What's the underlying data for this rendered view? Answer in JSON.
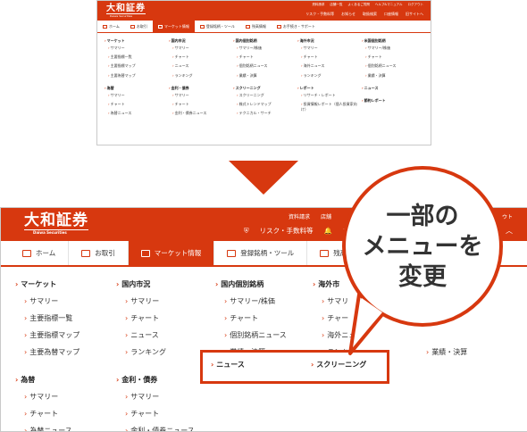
{
  "thumbnail": {
    "logo": "大和証券",
    "logo_sub": "Daiwa Securities",
    "util_top": [
      "資料請求",
      "店舗一覧",
      "よくあるご質問",
      "ヘルプ&マニュアル",
      "ログアウト"
    ],
    "util_bottom": [
      "リスク・手数料等",
      "お知らせ",
      "取扱検索",
      "口座情報",
      "旧サイトへ"
    ],
    "tabs": [
      "ホーム",
      "お取引",
      "マーケット情報",
      "登録銘柄・ツール",
      "残高情報",
      "お手続き・サポート"
    ],
    "columns": [
      {
        "head": "マーケット",
        "items": [
          "サマリー",
          "主要指標一覧",
          "主要指標マップ",
          "主要為替マップ"
        ]
      },
      {
        "head": "国内市況",
        "items": [
          "サマリー",
          "チャート",
          "ニュース",
          "ランキング"
        ]
      },
      {
        "head": "国内個別銘柄",
        "items": [
          "サマリー/株価",
          "チャート",
          "個別銘柄ニュース",
          "業績・決算"
        ]
      },
      {
        "head": "海外市況",
        "items": [
          "サマリー",
          "チャート",
          "海外ニュース",
          "ランキング"
        ]
      },
      {
        "head": "米国個別銘柄",
        "items": [
          "サマリー/株価",
          "チャート",
          "個別銘柄ニュース",
          "業績・決算"
        ]
      },
      {
        "head": "為替",
        "items": [
          "サマリー",
          "チャート",
          "為替ニュース"
        ]
      },
      {
        "head": "金利・債券",
        "items": [
          "サマリー",
          "チャート",
          "金利・債券ニュース"
        ]
      },
      {
        "head": "スクリーニング",
        "items": [
          "スクリーニング",
          "株式トレンドマップ",
          "テクニカル・サーチ"
        ]
      },
      {
        "head": "レポート",
        "items": [
          "リサーチ・レポート",
          "投資情報レポート（個人投資家向け）"
        ]
      },
      {
        "head": "ニュース",
        "items": []
      },
      {
        "head": "節約レポート",
        "items": []
      }
    ]
  },
  "big": {
    "logo": "大和証券",
    "logo_sub": "Daiwa Securities",
    "util_top": [
      "資料請求",
      "店舗"
    ],
    "util_bottom": [
      "リスク・手数料等",
      "お"
    ],
    "right_top": "ウト",
    "tabs": [
      "ホーム",
      "お取引",
      "マーケット情報",
      "登録銘柄・ツール",
      "残高情報",
      "お"
    ],
    "col1": {
      "head": "マーケット",
      "items": [
        "サマリー",
        "主要指標一覧",
        "主要指標マップ",
        "主要為替マップ"
      ],
      "head2": "為替",
      "items2": [
        "サマリー",
        "チャート",
        "為替ニュース"
      ]
    },
    "col2": {
      "head": "国内市況",
      "items": [
        "サマリー",
        "チャート",
        "ニュース",
        "ランキング"
      ],
      "head2": "金利・債券",
      "items2": [
        "サマリー",
        "チャート",
        "金利・債券ニュース"
      ]
    },
    "col3": {
      "head": "国内個別銘柄",
      "items": [
        "サマリー/株価",
        "チャート",
        "個別銘柄ニュース",
        "業績・決算"
      ]
    },
    "col4": {
      "head": "海外市",
      "items": [
        "サマリ",
        "チャー",
        "海外ニュー",
        "ランキン"
      ]
    },
    "col5_last": "業績・決算",
    "highlight_items": [
      "ニュース",
      "スクリーニング"
    ]
  },
  "callout": "一部の\nメニューを\n変更",
  "colors": {
    "accent": "#d7380f"
  }
}
